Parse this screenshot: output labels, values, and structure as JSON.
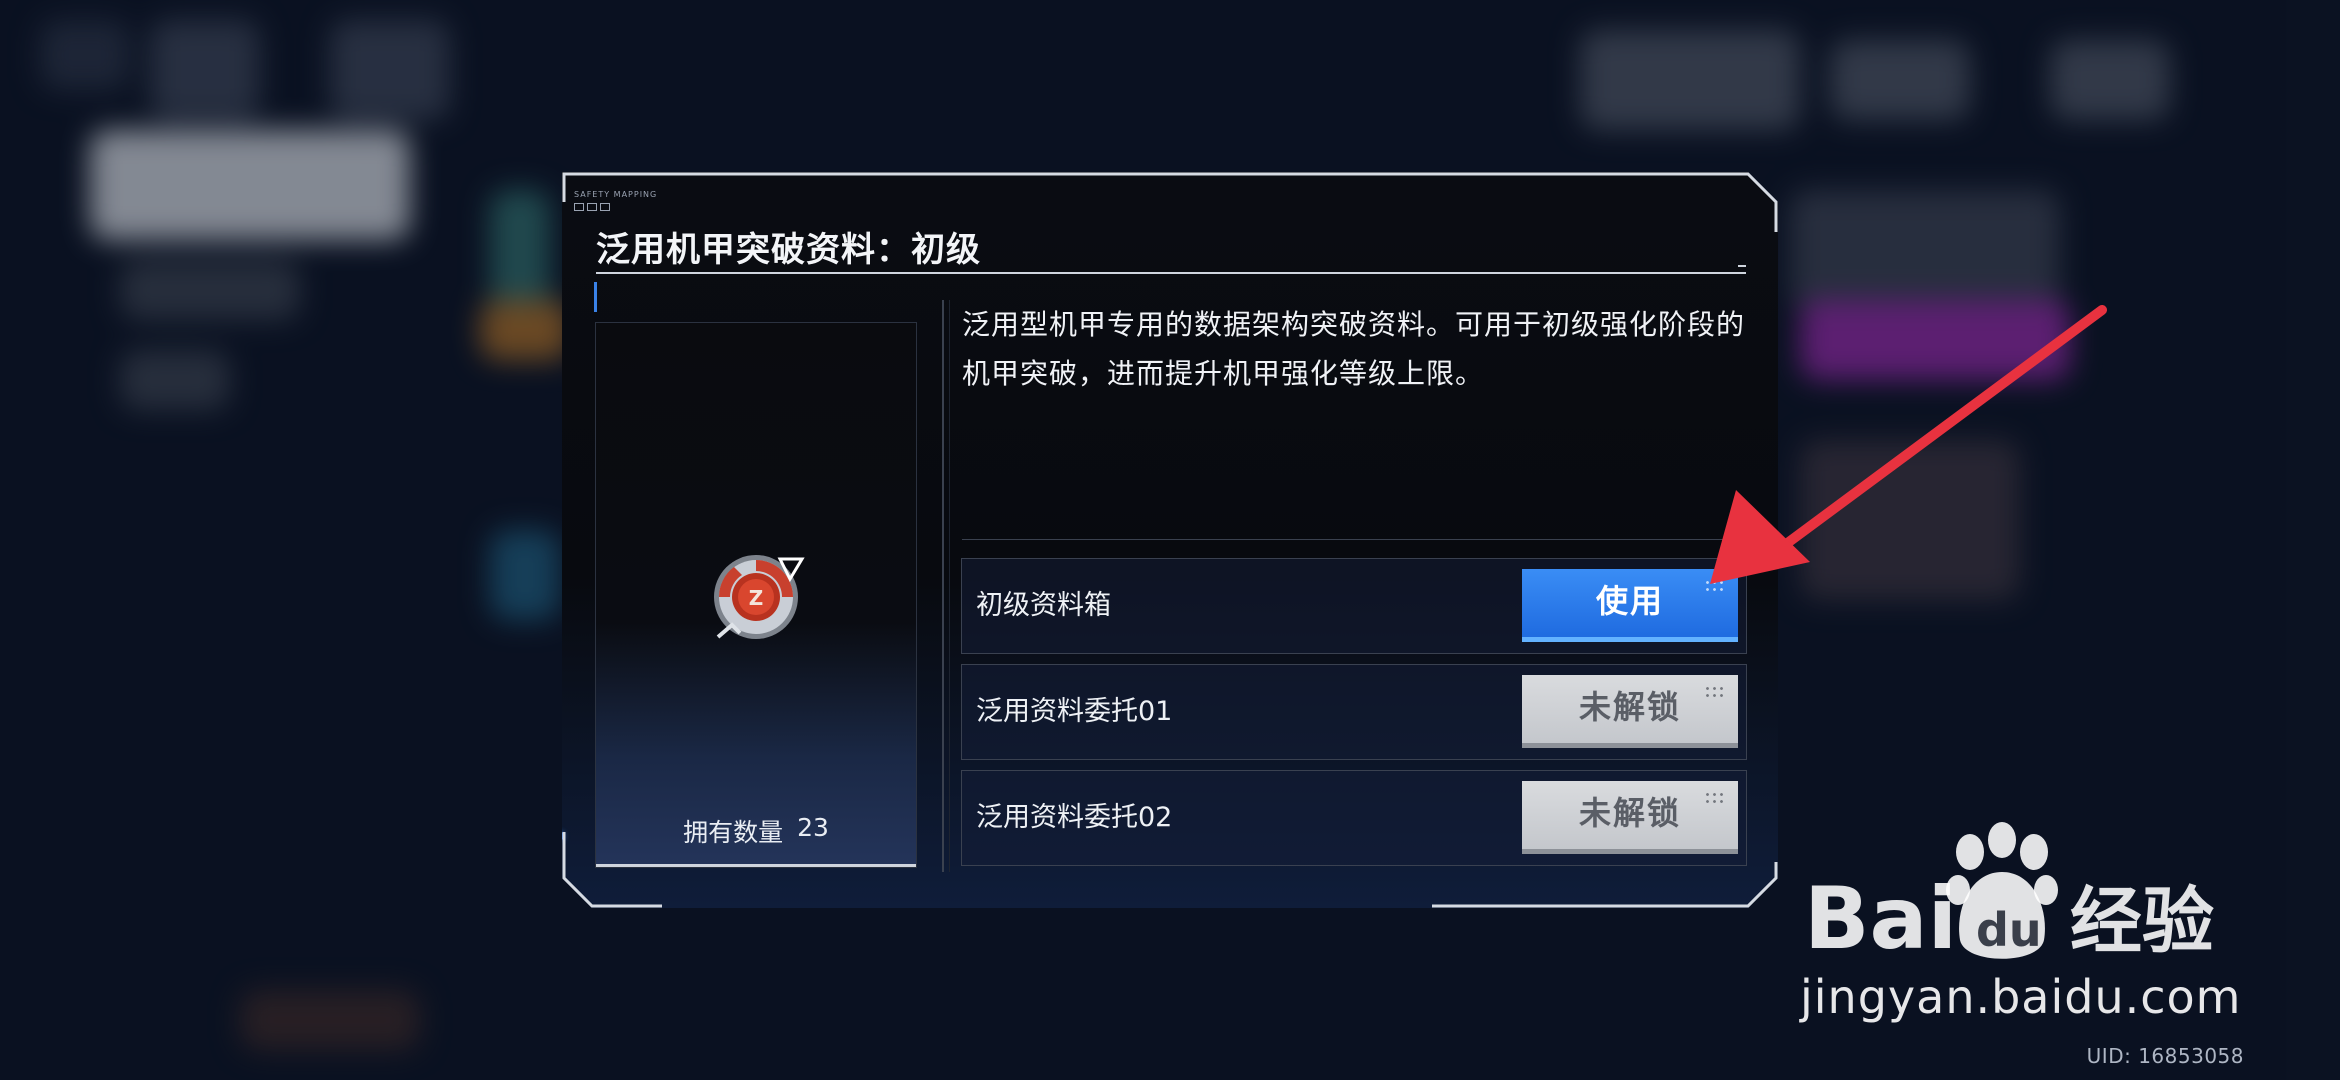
{
  "dialog": {
    "tag_text": "SAFETY MAPPING",
    "title": "泛用机甲突破资料：初级",
    "description": "泛用型机甲专用的数据架构突破资料。可用于初级强化阶段的机甲突破，进而提升机甲强化等级上限。"
  },
  "item": {
    "icon": "mech-breakthrough-chip-icon",
    "quantity_label": "拥有数量",
    "quantity": 23
  },
  "sources": [
    {
      "label": "初级资料箱",
      "button": "使用",
      "state": "available"
    },
    {
      "label": "泛用资料委托01",
      "button": "未解锁",
      "state": "locked"
    },
    {
      "label": "泛用资料委托02",
      "button": "未解锁",
      "state": "locked"
    }
  ],
  "watermark": {
    "brand": "Bai du 经验",
    "url": "jingyan.baidu.com"
  },
  "uid": "UID: 16853058",
  "colors": {
    "accent_blue": "#2a7ff0",
    "locked_gray": "#c9ccd1",
    "annotation_red": "#e8323f"
  }
}
